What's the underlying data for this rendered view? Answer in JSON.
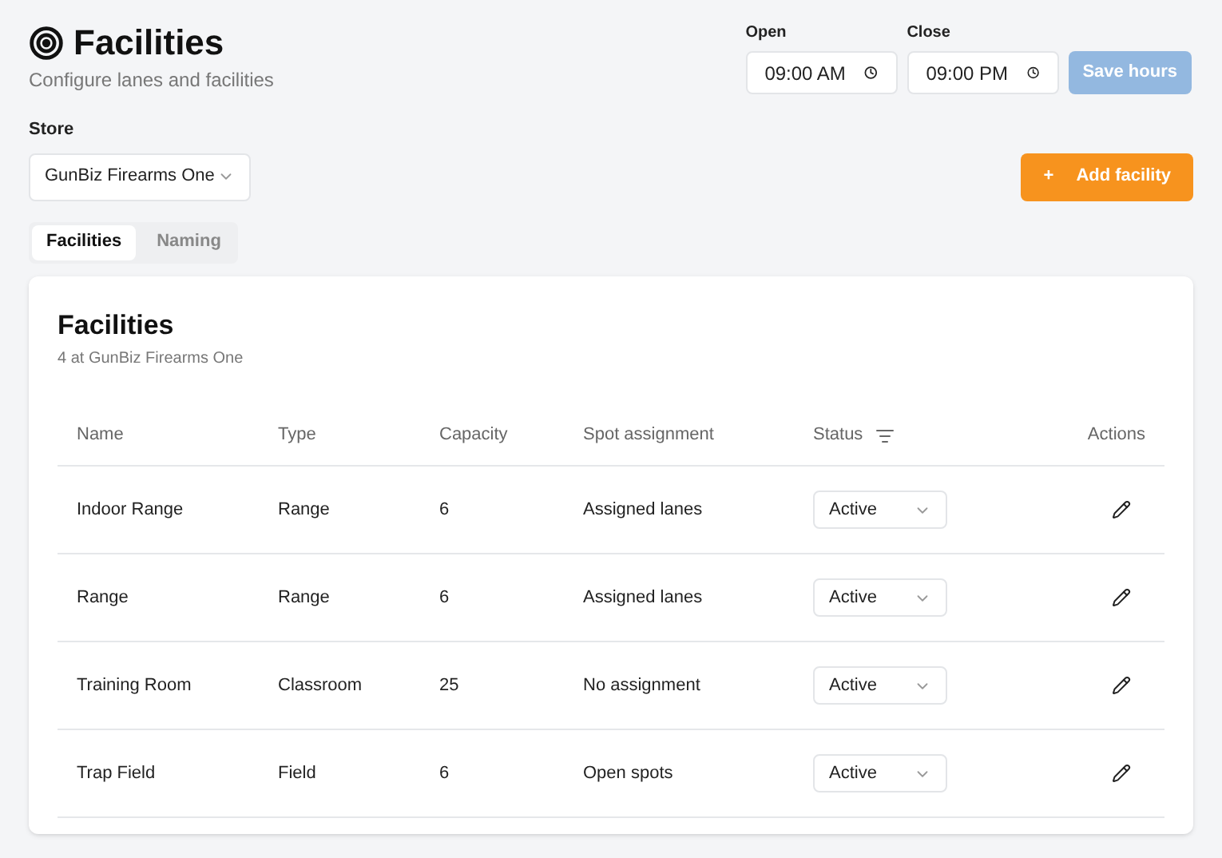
{
  "header": {
    "title": "Facilities",
    "subtitle": "Configure lanes and facilities"
  },
  "hours": {
    "open_label": "Open",
    "open_value": "09:00 AM",
    "close_label": "Close",
    "close_value": "09:00 PM",
    "save_button": "Save hours",
    "save_disabled": true
  },
  "store": {
    "label": "Store",
    "value": "GunBiz Firearms One"
  },
  "add_button": {
    "icon": "+",
    "label": "Add facility"
  },
  "tabs": [
    {
      "label": "Facilities",
      "selected": true
    },
    {
      "label": "Naming",
      "selected": false
    }
  ],
  "card": {
    "title": "Facilities",
    "subtitle": "4 at GunBiz Firearms One"
  },
  "table": {
    "columns": [
      "Name",
      "Type",
      "Capacity",
      "Spot assignment",
      "Status",
      "Actions"
    ],
    "rows": [
      {
        "name": "Indoor Range",
        "type": "Range",
        "capacity": "6",
        "spot_assignment": "Assigned lanes",
        "status": "Active"
      },
      {
        "name": "Range",
        "type": "Range",
        "capacity": "6",
        "spot_assignment": "Assigned lanes",
        "status": "Active"
      },
      {
        "name": "Training Room",
        "type": "Classroom",
        "capacity": "25",
        "spot_assignment": "No assignment",
        "status": "Active"
      },
      {
        "name": "Trap Field",
        "type": "Field",
        "capacity": "6",
        "spot_assignment": "Open spots",
        "status": "Active"
      }
    ]
  }
}
